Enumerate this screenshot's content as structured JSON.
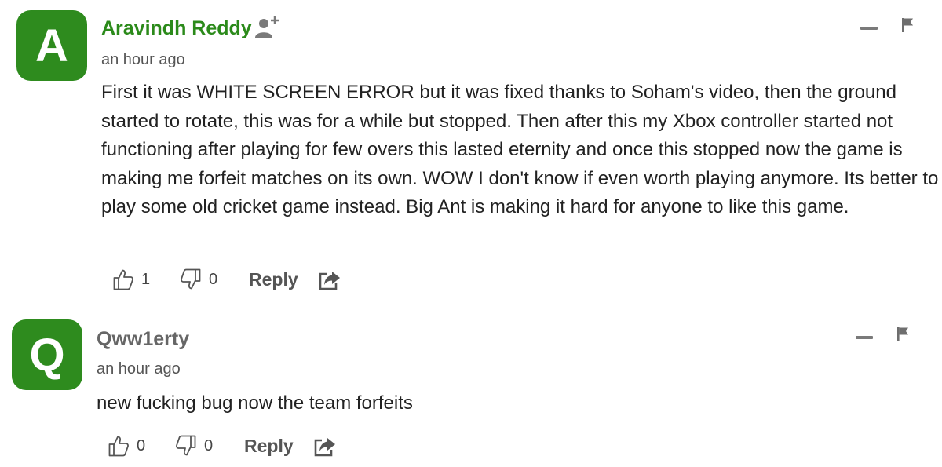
{
  "comments": [
    {
      "avatar_letter": "A",
      "author": "Aravindh Reddy",
      "time": "an hour ago",
      "text": "First it was WHITE SCREEN ERROR but it was fixed thanks to Soham's video, then the ground started to rotate, this was for a while but stopped. Then after this my Xbox controller started not functioning after playing for few overs this lasted eternity and once this stopped now the game is making me forfeit matches on its own. WOW I don't know if even worth playing anymore. Its better to play some old cricket game instead. Big Ant is making it hard for anyone to like this game.",
      "likes": "1",
      "dislikes": "0",
      "reply_label": "Reply"
    },
    {
      "avatar_letter": "Q",
      "author": "Qww1erty",
      "time": "an hour ago",
      "text": "new fucking bug now the team forfeits",
      "likes": "0",
      "dislikes": "0",
      "reply_label": "Reply"
    }
  ],
  "colors": {
    "avatar_bg": "#2e8b1e",
    "author_highlight": "#2b8a1a",
    "author_default": "#666666"
  },
  "icons": [
    "follow-user-icon",
    "collapse-icon",
    "flag-icon",
    "thumbs-up-icon",
    "thumbs-down-icon",
    "share-icon"
  ]
}
